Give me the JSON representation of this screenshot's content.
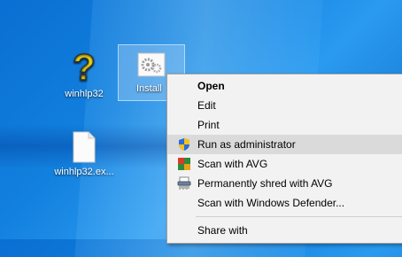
{
  "desktop": {
    "icons": [
      {
        "label": "winhlp32"
      },
      {
        "label": "Install"
      },
      {
        "label": "winhlp32.ex..."
      }
    ]
  },
  "context_menu": {
    "items": [
      {
        "label": "Open",
        "icon": ""
      },
      {
        "label": "Edit",
        "icon": ""
      },
      {
        "label": "Print",
        "icon": ""
      },
      {
        "label": "Run as administrator",
        "icon": "uac-shield-icon"
      },
      {
        "label": "Scan with AVG",
        "icon": "avg-icon"
      },
      {
        "label": "Permanently shred with AVG",
        "icon": "shredder-icon"
      },
      {
        "label": "Scan with Windows Defender...",
        "icon": ""
      },
      {
        "label": "Share with",
        "icon": ""
      }
    ]
  },
  "colors": {
    "desktop": "#1280de",
    "menu_bg": "#f2f2f2",
    "menu_highlight": "#dadada"
  }
}
